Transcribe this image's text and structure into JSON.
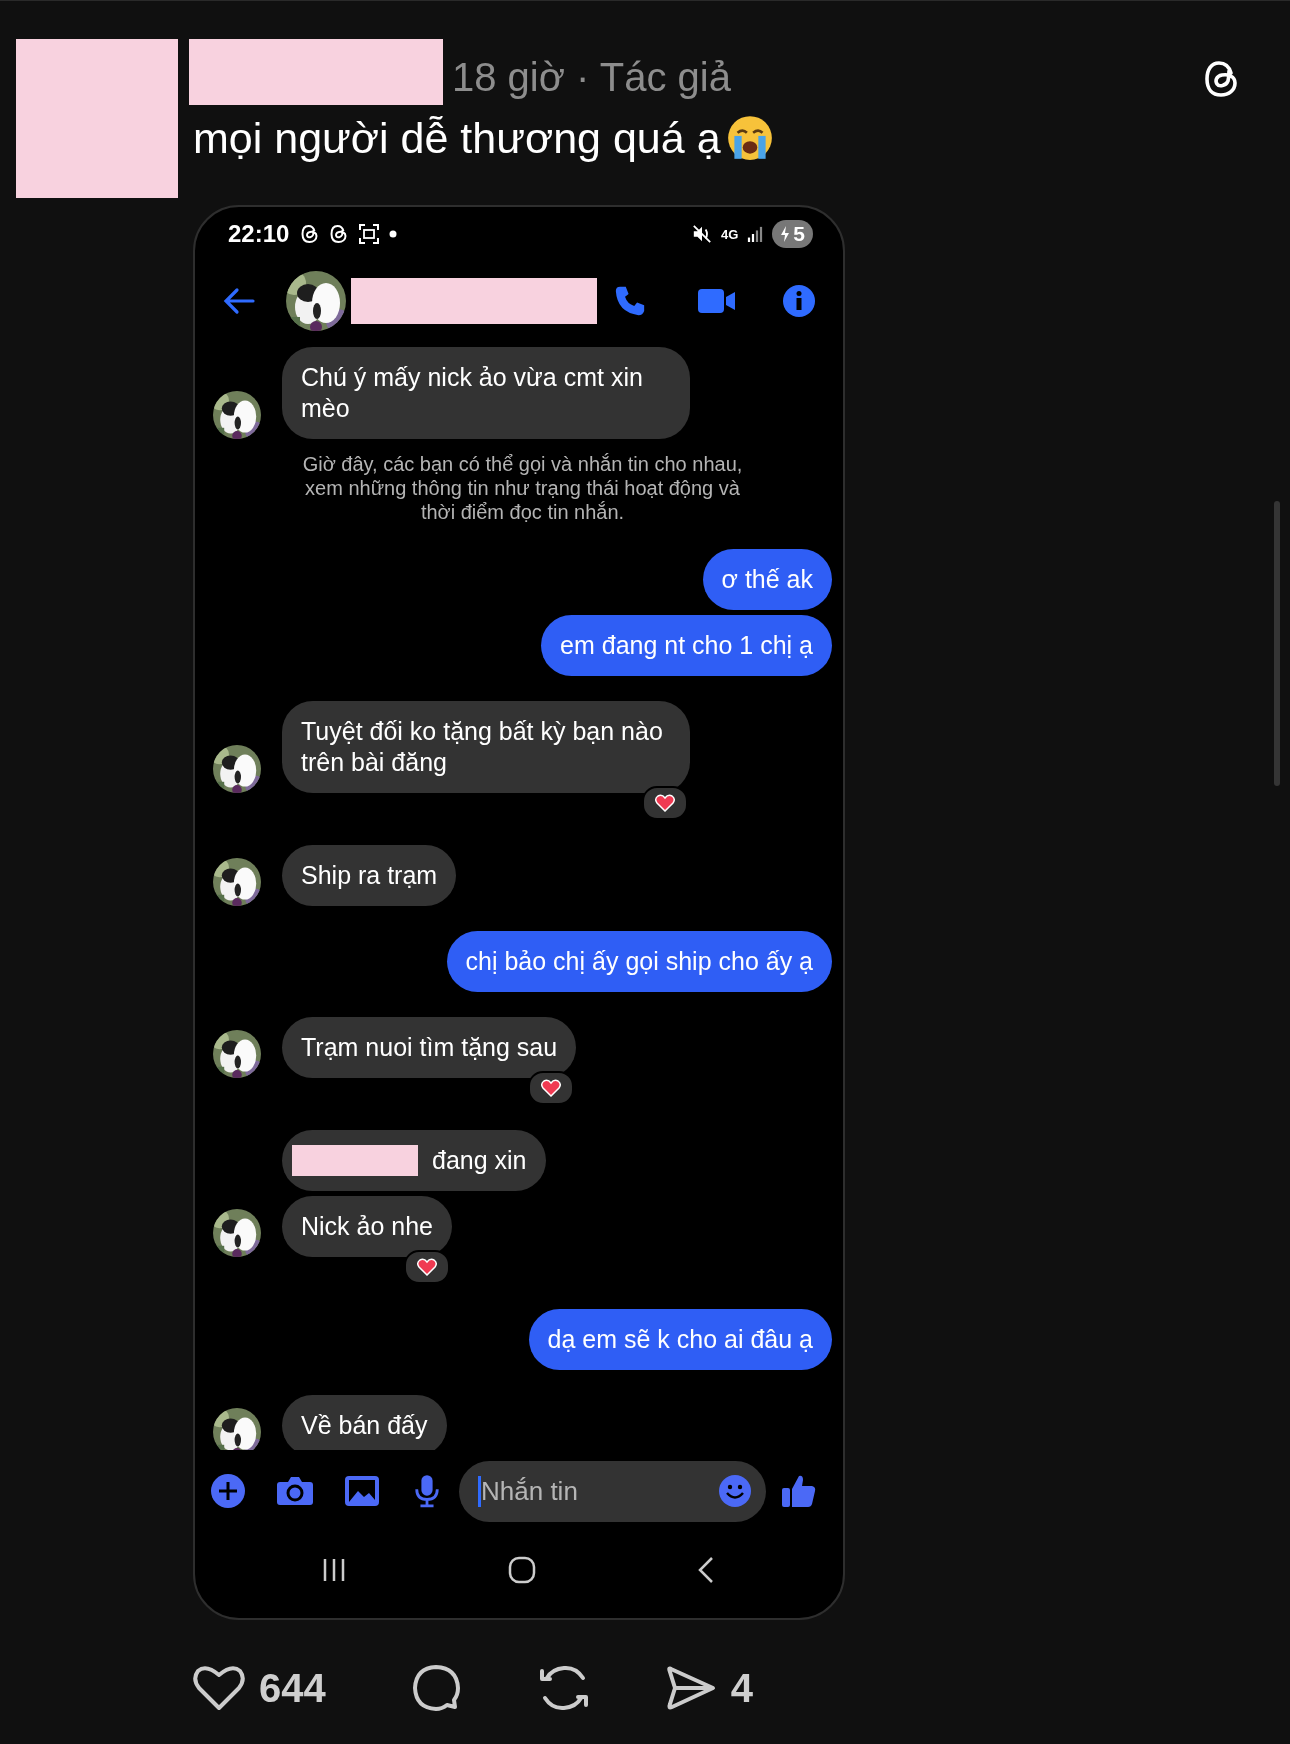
{
  "post": {
    "meta": "18 giờ · Tác giả",
    "caption": "mọi người dễ thương quá ạ"
  },
  "status_bar": {
    "time": "22:10",
    "network": "4G",
    "battery": "5"
  },
  "chat": {
    "messages": [
      {
        "kind": "incoming",
        "text": "Chú ý mấy nick ảo vừa cmt xin mèo",
        "avatar": true,
        "reacted": false,
        "redacted": false
      },
      {
        "kind": "notice",
        "text": "Giờ đây, các bạn có thể gọi và nhắn tin cho nhau, xem những thông tin như trạng thái hoạt động và thời điểm đọc tin nhắn."
      },
      {
        "kind": "outgoing",
        "text": "ơ thế ak",
        "reacted": false
      },
      {
        "kind": "outgoing",
        "text": "em đang nt cho 1 chị ạ",
        "reacted": false
      },
      {
        "kind": "incoming",
        "text": "Tuyệt đối ko tặng bất kỳ bạn nào trên bài đăng",
        "avatar": true,
        "reacted": true,
        "redacted": false
      },
      {
        "kind": "incoming",
        "text": "Ship ra trạm",
        "avatar": true,
        "reacted": false,
        "redacted": false
      },
      {
        "kind": "outgoing",
        "text": "chị bảo chị ấy gọi ship cho ấy ạ",
        "reacted": false
      },
      {
        "kind": "incoming",
        "text": "Trạm nuoi tìm tặng sau",
        "avatar": true,
        "reacted": true,
        "redacted": false
      },
      {
        "kind": "incoming",
        "text": "đang xin",
        "avatar": false,
        "reacted": false,
        "redacted": true
      },
      {
        "kind": "incoming",
        "text": "Nick ảo nhe",
        "avatar": true,
        "reacted": true,
        "redacted": false
      },
      {
        "kind": "outgoing",
        "text": "dạ em sẽ k cho ai đâu ạ",
        "reacted": false
      },
      {
        "kind": "incoming",
        "text": "Về bán đấy",
        "avatar": true,
        "reacted": false,
        "redacted": false
      }
    ],
    "composer": {
      "placeholder": "Nhắn tin"
    }
  },
  "actions": {
    "likes": "644",
    "shares": "4"
  }
}
